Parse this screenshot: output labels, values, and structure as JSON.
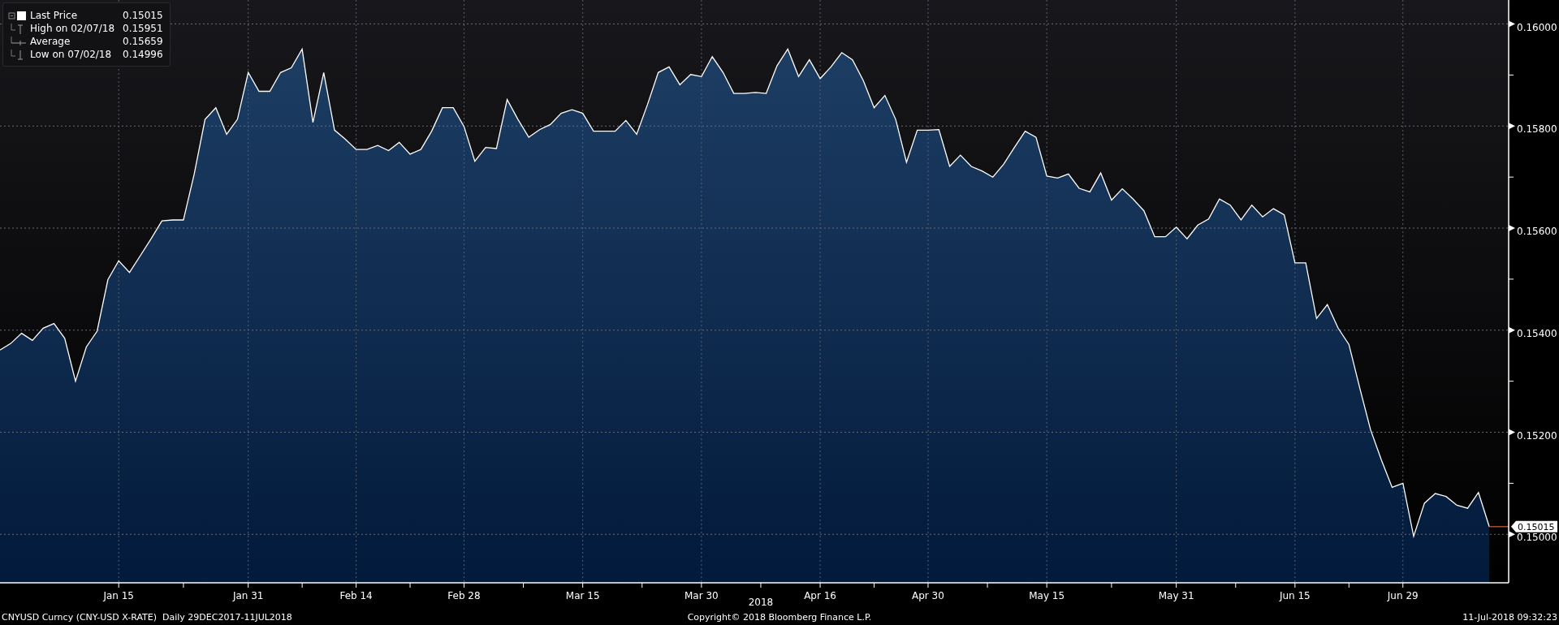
{
  "legend": [
    {
      "kind": "last",
      "value": "0.15015"
    },
    {
      "kind": "high",
      "label": "High on 02/07/18",
      "value": "0.15951"
    },
    {
      "kind": "average",
      "label": "Average",
      "value": "0.15659"
    },
    {
      "kind": "low",
      "label": "Low on 07/02/18",
      "value": "0.14996"
    }
  ],
  "chart_data": {
    "type": "area",
    "grid": true,
    "ylim": [
      0.14905,
      0.16047
    ],
    "categories": [
      null,
      null,
      null,
      null,
      null,
      null,
      null,
      null,
      null,
      null,
      null,
      "Jan 15",
      null,
      null,
      null,
      null,
      null,
      null,
      null,
      null,
      null,
      null,
      null,
      "Jan 31",
      null,
      null,
      null,
      null,
      null,
      null,
      null,
      null,
      null,
      "Feb 14",
      null,
      null,
      null,
      null,
      null,
      null,
      null,
      null,
      null,
      "Feb 28",
      null,
      null,
      null,
      null,
      null,
      null,
      null,
      null,
      null,
      null,
      "Mar 15",
      null,
      null,
      null,
      null,
      null,
      null,
      null,
      null,
      null,
      null,
      "Mar 30",
      null,
      null,
      null,
      null,
      null,
      null,
      null,
      null,
      null,
      null,
      "Apr 16",
      null,
      null,
      null,
      null,
      null,
      null,
      null,
      null,
      null,
      "Apr 30",
      null,
      null,
      null,
      null,
      null,
      null,
      null,
      null,
      null,
      null,
      "May 15",
      null,
      null,
      null,
      null,
      null,
      null,
      null,
      null,
      null,
      null,
      null,
      "May 31",
      null,
      null,
      null,
      null,
      null,
      null,
      null,
      null,
      null,
      null,
      "Jun 15",
      null,
      null,
      null,
      null,
      null,
      null,
      null,
      null,
      null,
      "Jun 29",
      null,
      null,
      null,
      null,
      null,
      null,
      null,
      null
    ],
    "yticks": [
      {
        "value": 0.15,
        "label": "0.15000"
      },
      {
        "value": 0.152,
        "label": "0.15200"
      },
      {
        "value": 0.154,
        "label": "0.15400"
      },
      {
        "value": 0.156,
        "label": "0.15600"
      },
      {
        "value": 0.158,
        "label": "0.15800"
      },
      {
        "value": 0.16,
        "label": "0.16000"
      }
    ],
    "series": [
      {
        "name": "Last Price",
        "color": "#ffffff",
        "values": [
          0.15361,
          0.15374,
          0.15394,
          0.1538,
          0.15404,
          0.15413,
          0.15384,
          0.153,
          0.15367,
          0.15398,
          0.15499,
          0.15536,
          0.15513,
          0.15546,
          0.15579,
          0.15614,
          0.15616,
          0.15616,
          0.15706,
          0.15813,
          0.15836,
          0.15784,
          0.15813,
          0.15905,
          0.15868,
          0.15868,
          0.15905,
          0.15914,
          0.15951,
          0.15807,
          0.15905,
          0.15792,
          0.15774,
          0.15754,
          0.15754,
          0.15762,
          0.15752,
          0.15768,
          0.15745,
          0.15754,
          0.1579,
          0.15836,
          0.15836,
          0.15799,
          0.15731,
          0.15758,
          0.15756,
          0.15852,
          0.15813,
          0.15778,
          0.15793,
          0.15803,
          0.15825,
          0.15832,
          0.15825,
          0.1579,
          0.1579,
          0.1579,
          0.15811,
          0.15784,
          0.15842,
          0.15905,
          0.15916,
          0.15881,
          0.15901,
          0.15897,
          0.15936,
          0.15905,
          0.15864,
          0.15864,
          0.15866,
          0.15864,
          0.15918,
          0.15951,
          0.15897,
          0.1593,
          0.15893,
          0.15916,
          0.15944,
          0.1593,
          0.15889,
          0.15836,
          0.1586,
          0.15813,
          0.15729,
          0.15792,
          0.15792,
          0.15793,
          0.15721,
          0.15743,
          0.15721,
          0.15712,
          0.157,
          0.15725,
          0.15758,
          0.1579,
          0.15778,
          0.15702,
          0.15698,
          0.15706,
          0.15678,
          0.15671,
          0.15708,
          0.15655,
          0.15677,
          0.15657,
          0.15634,
          0.15583,
          0.15583,
          0.15602,
          0.15579,
          0.15606,
          0.15618,
          0.15657,
          0.15645,
          0.15616,
          0.15645,
          0.15622,
          0.15638,
          0.15626,
          0.15532,
          0.15532,
          0.15423,
          0.1545,
          0.15404,
          0.15372,
          0.15287,
          0.15205,
          0.15146,
          0.15092,
          0.151,
          0.14996,
          0.15061,
          0.1508,
          0.15074,
          0.15057,
          0.15051,
          0.15082,
          0.15015
        ]
      }
    ]
  },
  "last_price_tag": "0.15015",
  "axis_year": "2018",
  "footer": {
    "left": "CNYUSD Curncy (CNY-USD X-RATE)  Daily 29DEC2017-11JUL2018",
    "center": "Copyright© 2018 Bloomberg Finance L.P.",
    "right": "11-Jul-2018 09:32:23"
  }
}
